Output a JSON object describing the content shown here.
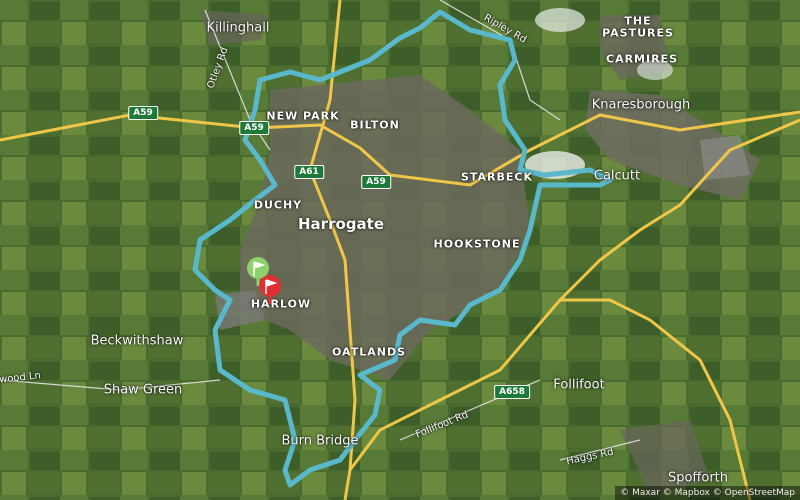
{
  "map": {
    "attribution": "© Maxar © Mapbox © OpenStreetMap",
    "colors": {
      "route": "#5ab8cc",
      "major_road": "#f0c648",
      "minor_road": "#e6e6e6",
      "start_flag": "#8fd16a",
      "end_flag": "#e03030"
    },
    "districts": [
      "NEW PARK",
      "BILTON",
      "DUCHY",
      "STARBECK",
      "HOOKSTONE",
      "HARLOW",
      "OATLANDS",
      "THE",
      "PASTURES",
      "CARMIRES"
    ],
    "towns": [
      "Killinghall",
      "Harrogate",
      "Knaresborough",
      "Calcutt",
      "Beckwithshaw",
      "Shaw Green",
      "Burn Bridge",
      "Follifoot",
      "Spofforth"
    ],
    "roads": [
      "Otley Rd",
      "Ripley Rd",
      "Follifoot Rd",
      "Haggs Rd",
      "wood Ln"
    ],
    "shields": [
      "A59",
      "A59",
      "A61",
      "A59",
      "A658"
    ],
    "markers": {
      "start": "start-flag-icon",
      "end": "end-flag-icon"
    }
  }
}
